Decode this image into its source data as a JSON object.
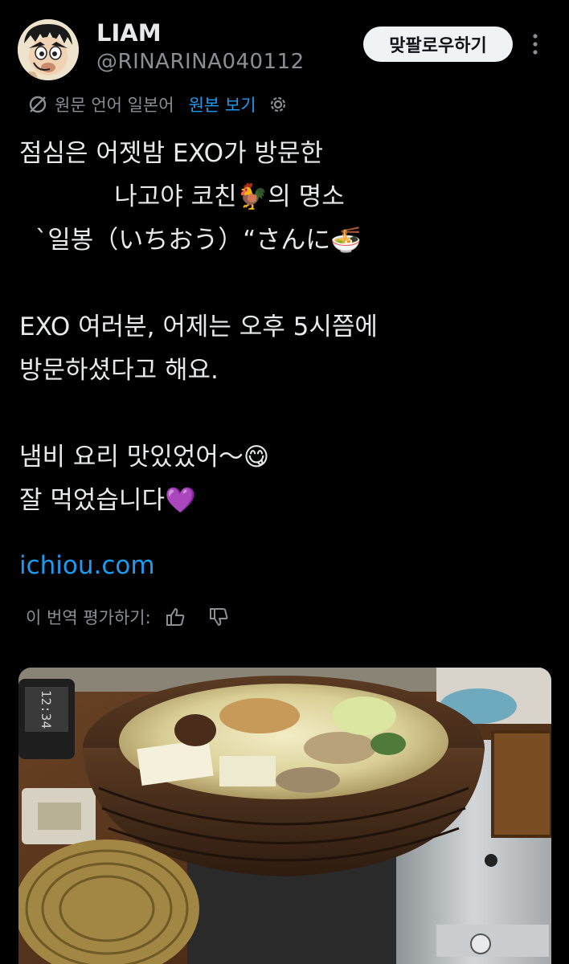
{
  "author": {
    "display_name": "LIAM",
    "handle": "@RINARINA040112"
  },
  "follow_button": {
    "label": "맞팔로우하기"
  },
  "translation": {
    "source_language": "원문 언어 일본어",
    "show_original": "원본 보기"
  },
  "tweet": {
    "text": "점심은 어젯밤 EXO가 방문한\n            나고야 코친🐓의 명소\n  ˋ일봉（いちおう）“さんに🍜\n\nEXO 여러분, 어제는 오후 5시쯤에\n방문하셨다고 해요.\n\n냄비 요리 맛있었어〜😋\n잘 먹었습니다💜",
    "link": "ichiou.com"
  },
  "rating": {
    "label": "이 번역 평가하기:"
  },
  "icons": [
    "avatar-illustration",
    "translate-off-icon",
    "gear-icon",
    "more-icon",
    "thumbs-up-icon",
    "thumbs-down-icon"
  ],
  "photo": {
    "clock_text": "12:34"
  },
  "colors": {
    "accent": "#1d9bf0",
    "background": "#000000",
    "secondary_text": "#8b8f94"
  }
}
